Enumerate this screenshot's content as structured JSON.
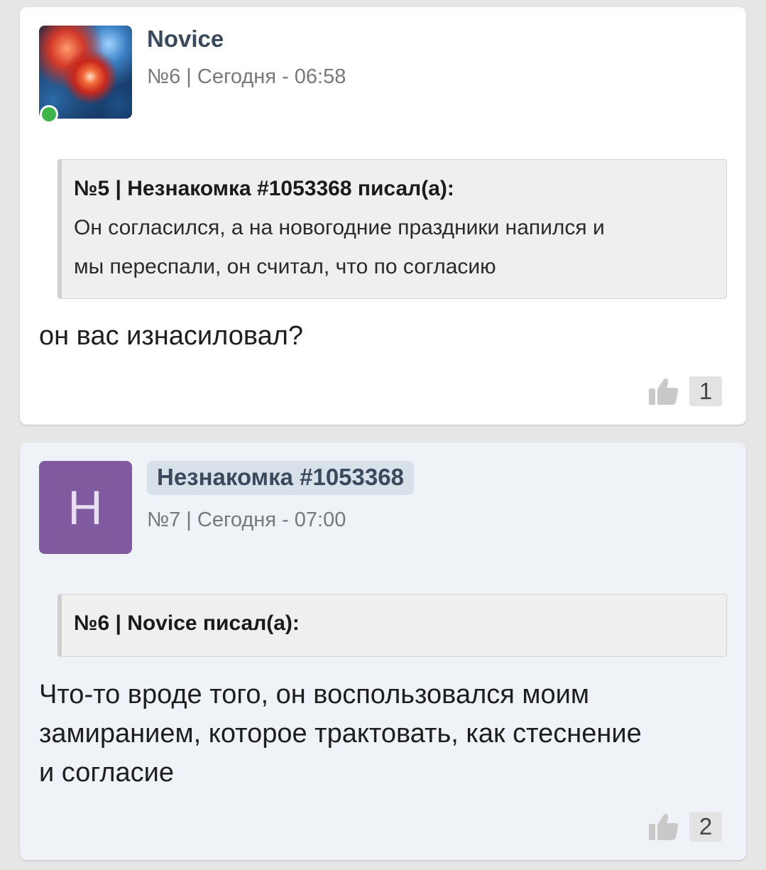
{
  "posts": [
    {
      "author": "Novice",
      "meta": "№6 | Сегодня - 06:58",
      "quote": {
        "header": "№5 | Незнакомка #1053368 писал(а):",
        "lines": [
          "Он согласился, а на новогодние праздники напился и",
          "мы переспали, он считал, что по согласию"
        ]
      },
      "text": "он вас изнасиловал?",
      "likes": "1"
    },
    {
      "avatar_letter": "Н",
      "author": "Незнакомка #1053368",
      "meta": "№7 | Сегодня - 07:00",
      "quote": {
        "header": "№6 | Novice писал(а):"
      },
      "text_lines": [
        "Что-то вроде того, он воспользовался моим",
        "замиранием, которое трактовать, как стеснение",
        "и согласие"
      ],
      "likes": "2"
    }
  ],
  "colors": {
    "page_bg": "#e6e6e6",
    "post_bg": "#ffffff",
    "post_alt_bg": "#eff2f6",
    "avatar_letter_bg": "#7f5a9e",
    "online": "#3db54a",
    "author_badge_bg": "#d8e0ea"
  },
  "icons": {
    "like": "thumbs-up-icon",
    "online": "online-status-dot"
  }
}
